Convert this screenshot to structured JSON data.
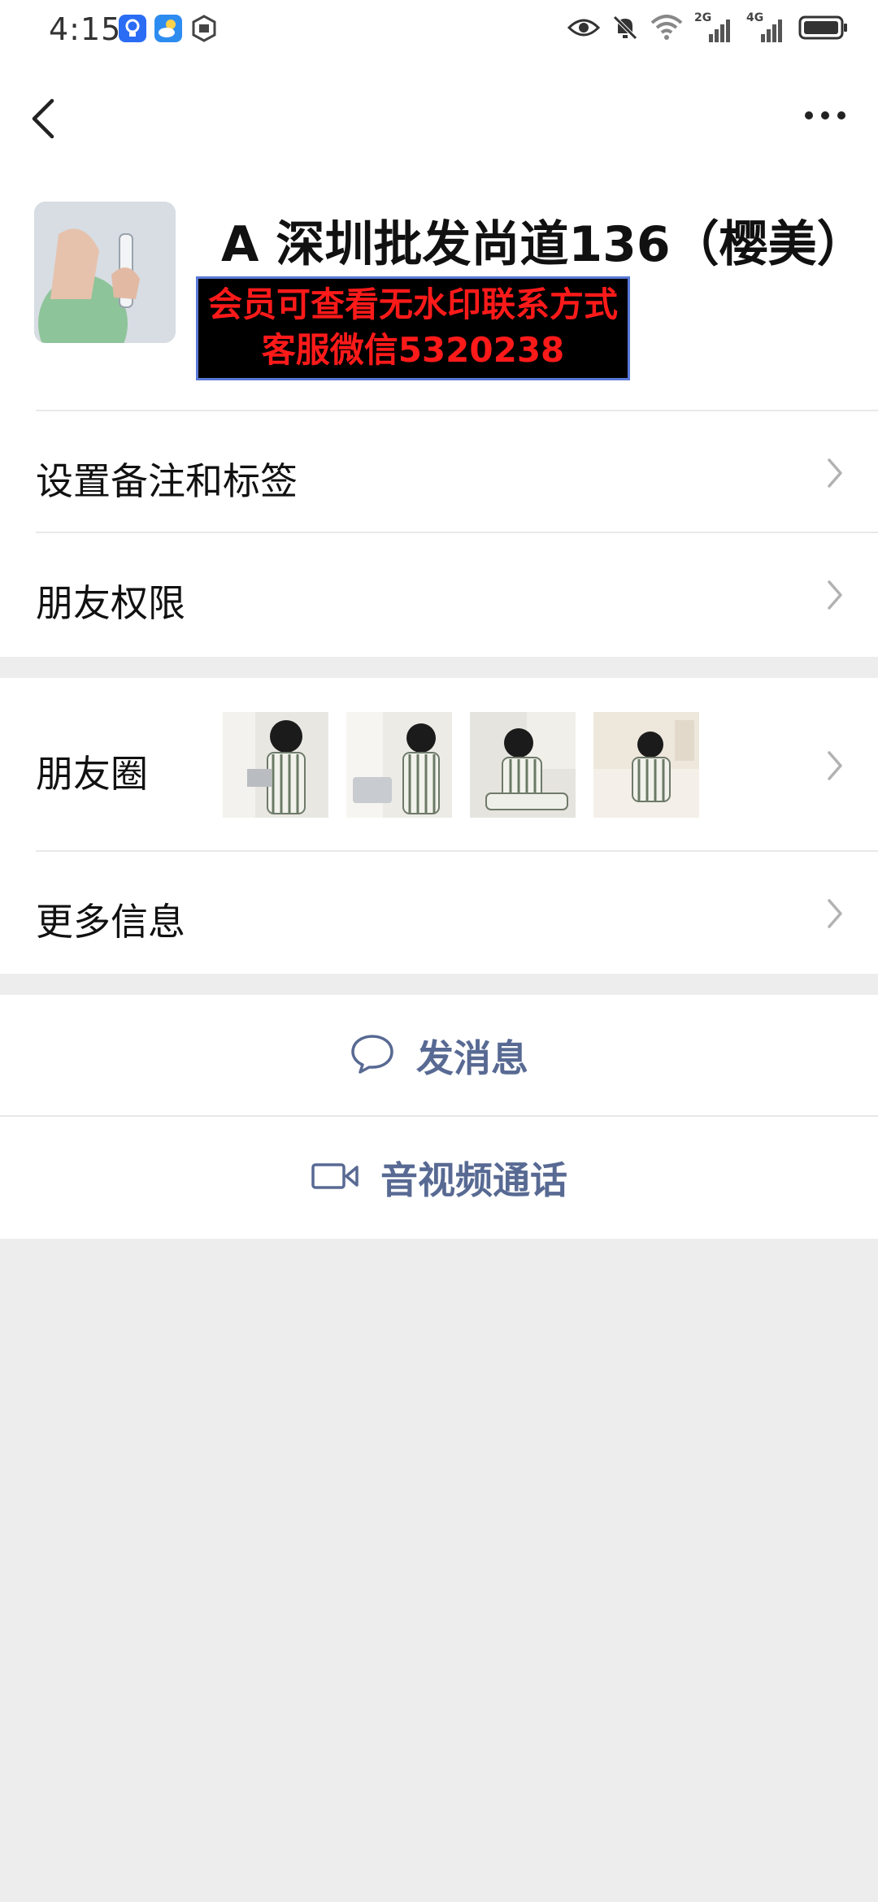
{
  "status_bar": {
    "time": "4:15",
    "network_2g": "2G",
    "network_4g": "4G"
  },
  "nav": {
    "back_icon": "chevron-left-icon",
    "more_icon": "more-dots-icon"
  },
  "profile": {
    "name": "A 深圳批发尚道136（樱美）",
    "watermark_line1": "会员可查看无水印联系方式",
    "watermark_line2": "客服微信5320238"
  },
  "menu": {
    "remark_label": "设置备注和标签",
    "permission_label": "朋友权限",
    "moments_label": "朋友圈",
    "more_info_label": "更多信息"
  },
  "actions": {
    "message_label": "发消息",
    "call_label": "音视频通话"
  },
  "colors": {
    "accent_link": "#586a93",
    "background": "#ededed",
    "watermark_text": "#ff1a1a"
  }
}
